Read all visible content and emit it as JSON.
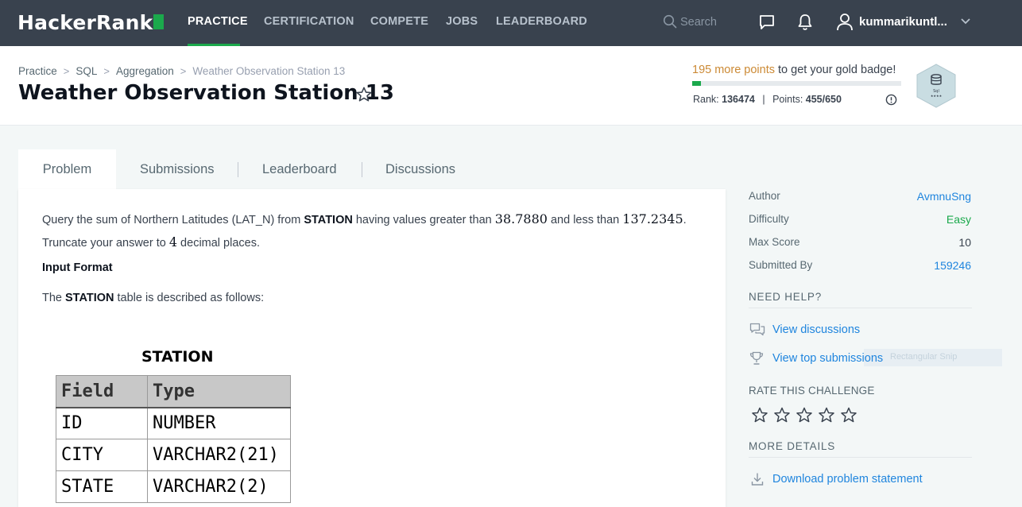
{
  "nav": {
    "logo": "HackerRank",
    "items": [
      {
        "label": "PRACTICE",
        "active": true
      },
      {
        "label": "CERTIFICATION",
        "active": false
      },
      {
        "label": "COMPETE",
        "active": false
      },
      {
        "label": "JOBS",
        "active": false
      },
      {
        "label": "LEADERBOARD",
        "active": false
      }
    ],
    "search_placeholder": "Search",
    "username": "kummarikuntl...",
    "icons": [
      "search-icon",
      "messages-icon",
      "notifications-bell-icon",
      "user-icon",
      "chevron-down-icon"
    ]
  },
  "header": {
    "breadcrumb": [
      "Practice",
      "SQL",
      "Aggregation",
      "Weather Observation Station 13"
    ],
    "title": "Weather Observation Station 13",
    "badge_points_text": "195 more points",
    "badge_suffix_text": "to get your gold badge!",
    "progress": 0.04,
    "rank_label": "Rank:",
    "rank_value": "136474",
    "points_label": "Points:",
    "points_value": "455/650",
    "badge_caption": "Sql",
    "badge_stars": "★★★★"
  },
  "tabs": [
    {
      "label": "Problem",
      "active": true
    },
    {
      "label": "Submissions",
      "active": false
    },
    {
      "label": "Leaderboard",
      "active": false
    },
    {
      "label": "Discussions",
      "active": false
    }
  ],
  "problem": {
    "q_part1": "Query the sum of Northern Latitudes (LAT_N) from ",
    "q_bold": "STATION",
    "q_part2": " having values greater than ",
    "q_lower": "38.7880",
    "q_part3": " and less than ",
    "q_upper": "137.2345",
    "q_part4": ". Truncate your answer to ",
    "q_places": "4",
    "q_part5": " decimal places.",
    "input_format_heading": "Input Format",
    "desc_part1": "The ",
    "desc_bold": "STATION",
    "desc_part2": " table is described as follows:",
    "table_caption": "STATION",
    "table_headers": [
      "Field",
      "Type"
    ],
    "table_rows": [
      [
        "ID",
        "NUMBER"
      ],
      [
        "CITY",
        "VARCHAR2(21)"
      ],
      [
        "STATE",
        "VARCHAR2(2)"
      ]
    ]
  },
  "sidebar": {
    "details": [
      {
        "label": "Author",
        "value": "AvmnuSng",
        "style": "link"
      },
      {
        "label": "Difficulty",
        "value": "Easy",
        "style": "easy"
      },
      {
        "label": "Max Score",
        "value": "10",
        "style": "plain"
      },
      {
        "label": "Submitted By",
        "value": "159246",
        "style": "link"
      }
    ],
    "need_help_heading": "NEED HELP?",
    "help_links": [
      "View discussions",
      "View top submissions"
    ],
    "rate_heading": "RATE THIS CHALLENGE",
    "rating": 0,
    "more_details_heading": "MORE DETAILS",
    "download_link": "Download problem statement",
    "snip_overlay": "Rectangular Snip"
  },
  "colors": {
    "nav_bg": "#39424e",
    "accent_green": "#1ba94c",
    "link_blue": "#1f85de",
    "orange": "#cc8a35"
  }
}
